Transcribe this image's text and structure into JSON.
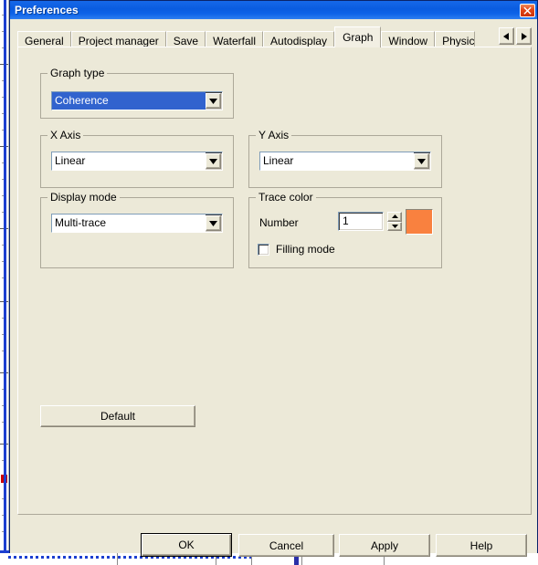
{
  "window": {
    "title": "Preferences",
    "close_icon": "close-icon",
    "titlebar_color": "#0a5ce0",
    "face_color": "#ece9d8"
  },
  "tabs": {
    "items": [
      {
        "label": "General",
        "selected": false
      },
      {
        "label": "Project manager",
        "selected": false
      },
      {
        "label": "Save",
        "selected": false
      },
      {
        "label": "Waterfall",
        "selected": false
      },
      {
        "label": "Autodisplay",
        "selected": false
      },
      {
        "label": "Graph",
        "selected": true
      },
      {
        "label": "Window",
        "selected": false
      },
      {
        "label": "Physic",
        "selected": false
      }
    ],
    "scroll_left_icon": "triangle-left-icon",
    "scroll_right_icon": "triangle-right-icon"
  },
  "graph_type": {
    "legend": "Graph type",
    "value": "Coherence",
    "highlighted": true,
    "highlight_color": "#3163ce",
    "dropdown_icon": "chevron-down-icon"
  },
  "x_axis": {
    "legend": "X Axis",
    "value": "Linear",
    "dropdown_icon": "chevron-down-icon"
  },
  "y_axis": {
    "legend": "Y Axis",
    "value": "Linear",
    "dropdown_icon": "chevron-down-icon"
  },
  "display_mode": {
    "legend": "Display mode",
    "value": "Multi-trace",
    "dropdown_icon": "chevron-down-icon"
  },
  "trace_color": {
    "legend": "Trace color",
    "number_label": "Number",
    "number_value": "1",
    "spin_up_icon": "triangle-up-icon",
    "spin_down_icon": "triangle-down-icon",
    "swatch_color": "#f9813f",
    "filling_mode_label": "Filling mode",
    "filling_mode_checked": false
  },
  "buttons": {
    "default_label": "Default",
    "ok_label": "OK",
    "cancel_label": "Cancel",
    "apply_label": "Apply",
    "help_label": "Help"
  }
}
